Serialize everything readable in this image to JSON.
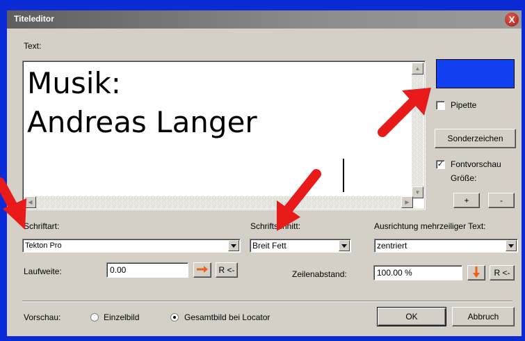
{
  "window": {
    "title": "Titeleditor",
    "close_glyph": "X"
  },
  "text_section": {
    "label": "Text:",
    "lines": "Musik:\nAndreas Langer"
  },
  "right_panel": {
    "pipette_label": "Pipette",
    "sonderzeichen_label": "Sonderzeichen",
    "fontvorschau_label": "Fontvorschau",
    "groesse_label": "Größe:",
    "plus_label": "+",
    "minus_label": "-"
  },
  "font": {
    "schriftart_label": "Schriftart:",
    "schriftart_value": "Tekton Pro",
    "schriftschnitt_label": "Schriftschnitt:",
    "schriftschnitt_value": "Breit Fett",
    "ausrichtung_label": "Ausrichtung mehrzeiliger Text:",
    "ausrichtung_value": "zentriert"
  },
  "spacing": {
    "laufweite_label": "Laufweite:",
    "laufweite_value": "0.00",
    "reset_left_label": "R <-",
    "zeilenabstand_label": "Zeilenabstand:",
    "zeilenabstand_value": "100.00 %",
    "reset_right_label": "R <-"
  },
  "preview": {
    "vorschau_label": "Vorschau:",
    "einzelbild_label": "Einzelbild",
    "gesamtbild_label": "Gesamtbild bei Locator"
  },
  "buttons": {
    "ok_label": "OK",
    "abbruch_label": "Abbruch"
  },
  "colors": {
    "swatch": "#1040f0",
    "arrow": "#e81a1a",
    "accent_orange": "#f06010"
  }
}
